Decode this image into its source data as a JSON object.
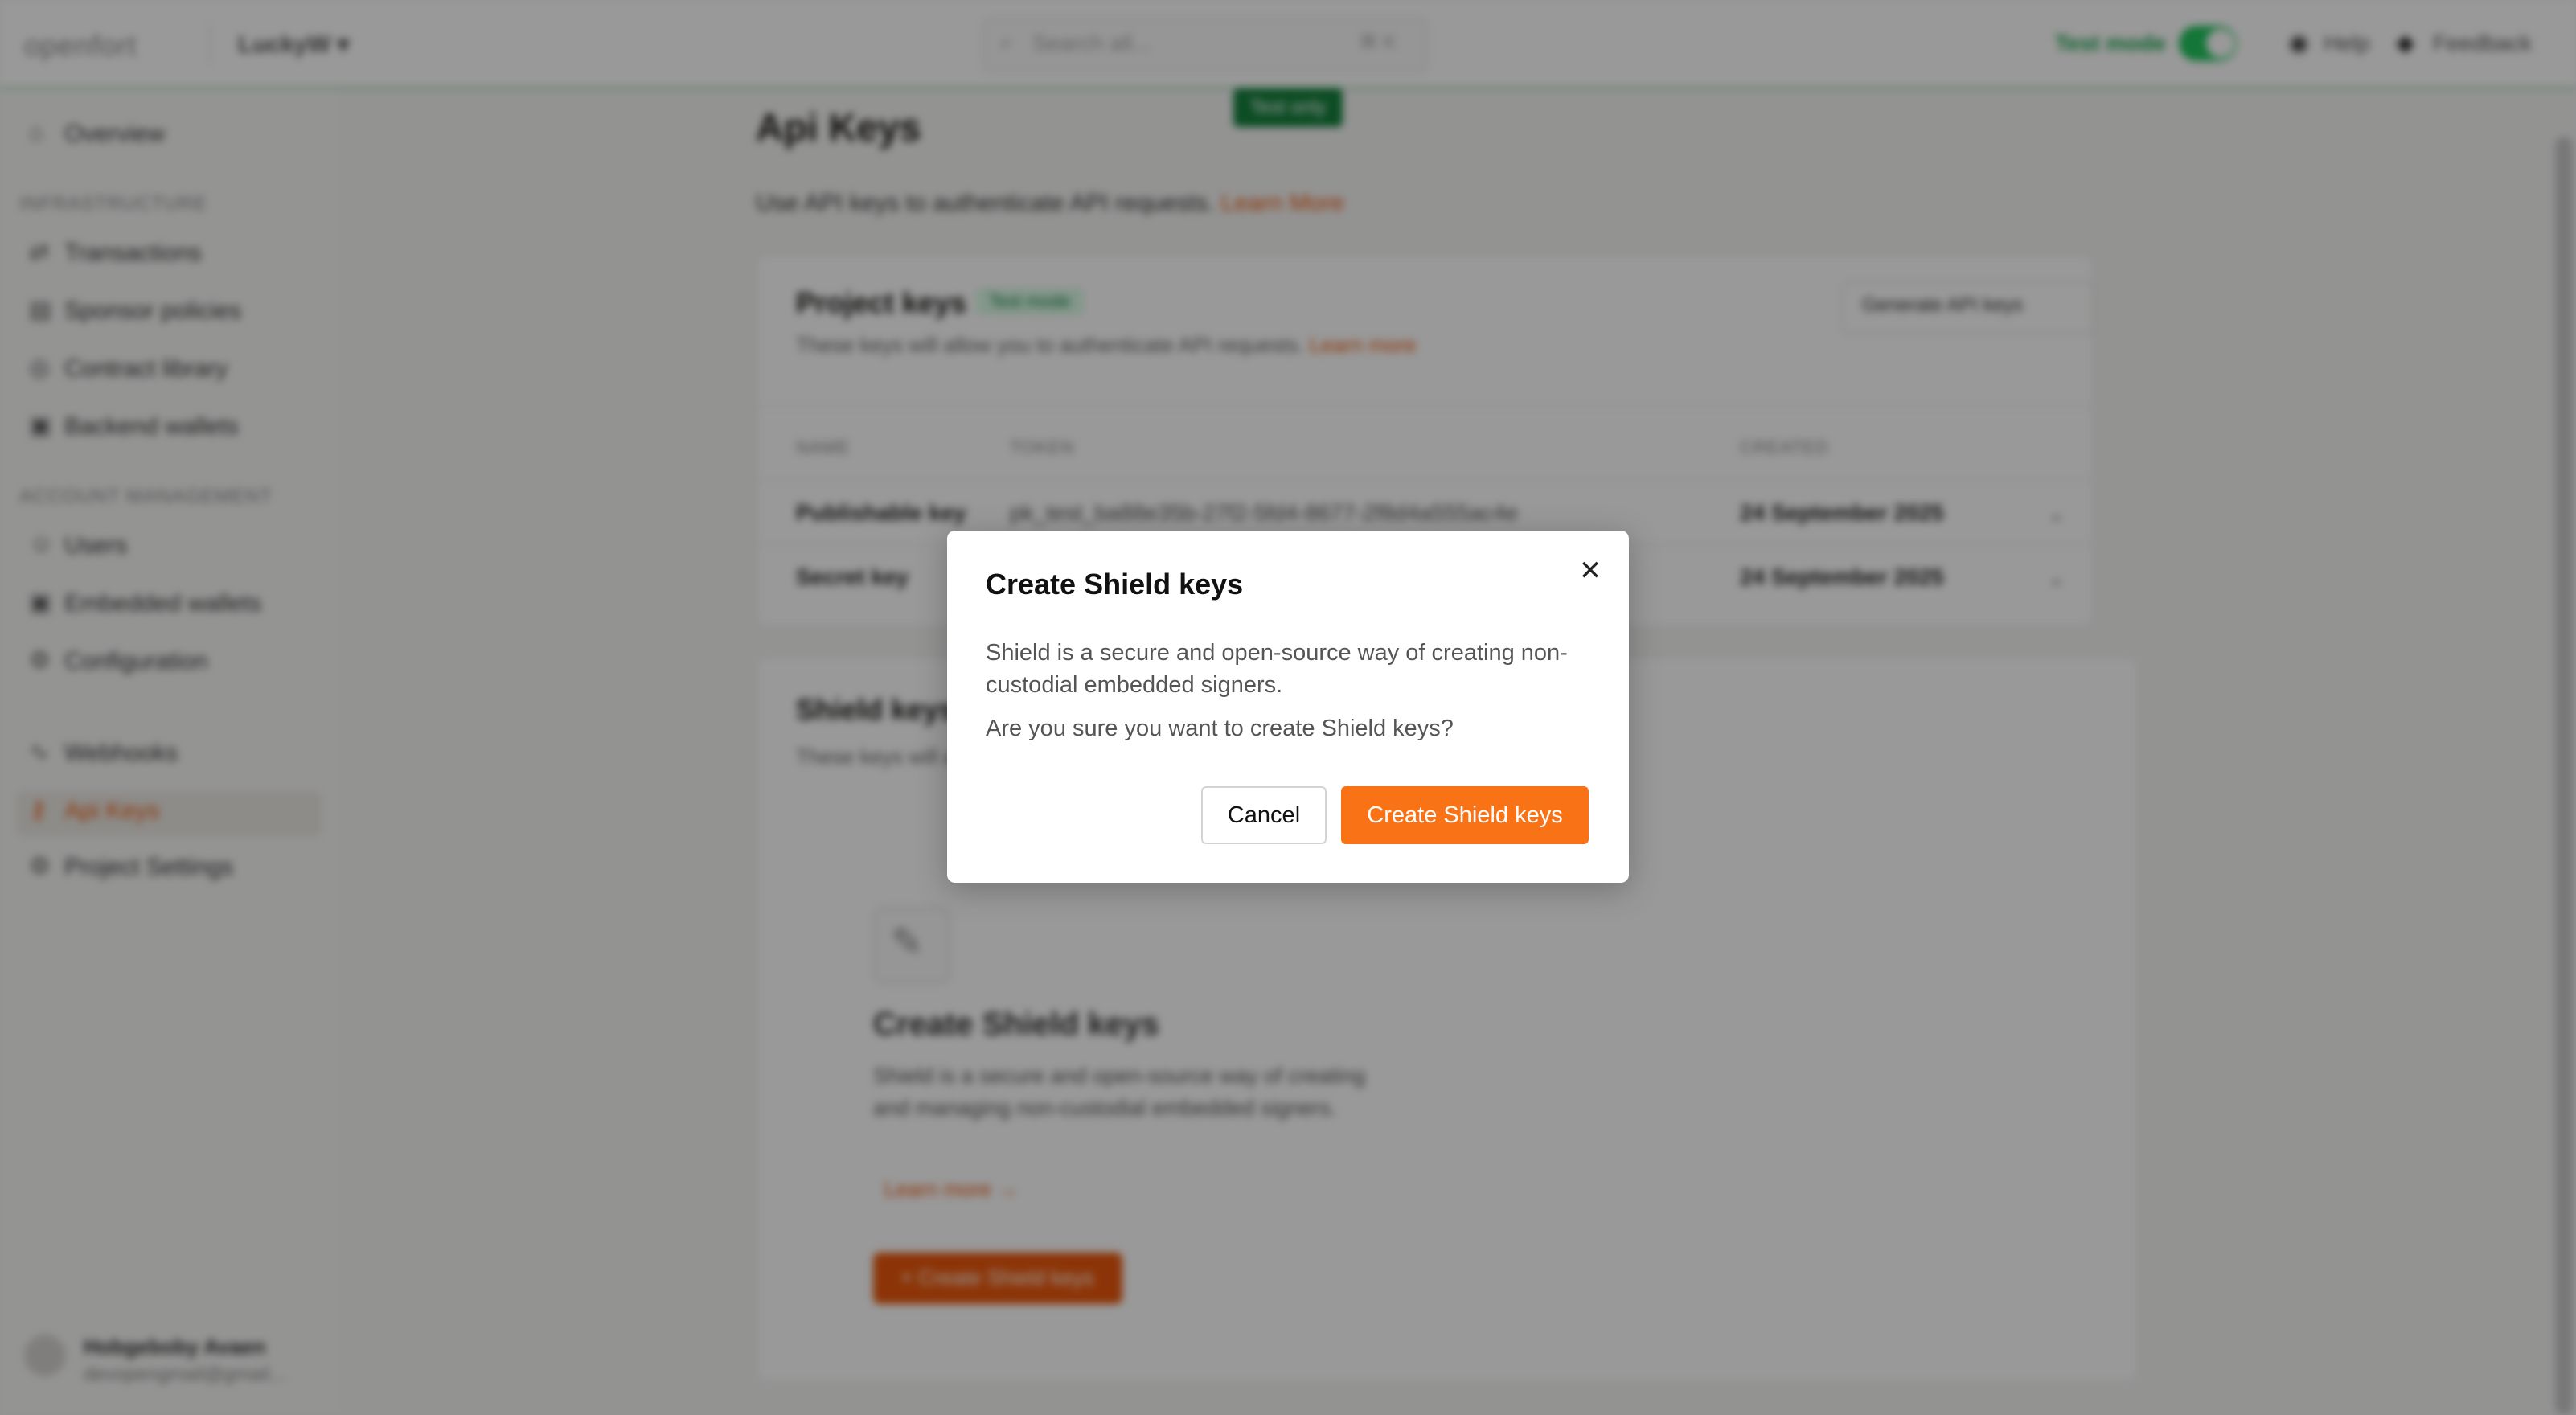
{
  "topbar": {
    "logo": "openfort",
    "project": "LuckyW",
    "project_chevron": "▾",
    "search_placeholder": "Search all...",
    "search_shortcut": "⌘ K",
    "test_mode_label": "Test mode",
    "help_label": "Help",
    "feedback_label": "Feedback",
    "test_pill": "Test only"
  },
  "sidebar": {
    "overview": "Overview",
    "section_infra": "INFRASTRUCTURE",
    "transactions": "Transactions",
    "sponsor_policies": "Sponsor policies",
    "contract_library": "Contract library",
    "backend_wallets": "Backend wallets",
    "section_account": "ACCOUNT MANAGEMENT",
    "users": "Users",
    "embedded_wallets": "Embedded wallets",
    "configuration": "Configuration",
    "webhooks": "Webhooks",
    "api_keys": "Api Keys",
    "project_settings": "Project Settings",
    "user_name": "Hobgeboby Avaen",
    "user_email": "devopengmail@gmail..."
  },
  "page": {
    "title": "Api Keys",
    "subtitle": "Use API keys to authenticate API requests.",
    "subtitle_link": "Learn More"
  },
  "project_keys": {
    "title": "Project keys",
    "badge": "Test mode",
    "subtitle": "These keys will allow you to authenticate API requests.",
    "subtitle_link": "Learn more",
    "generate_button": "Generate API keys",
    "columns": [
      "NAME",
      "TOKEN",
      "CREATED"
    ],
    "rows": [
      {
        "name": "Publishable key",
        "token": "pk_test_ba88e35b-27f2-5fd4-8677-2f8d4a555ac4e",
        "created": "24 September 2025"
      },
      {
        "name": "Secret key",
        "token": "",
        "created": "24 September 2025"
      }
    ]
  },
  "shield_card": {
    "title": "Shield keys",
    "subtitle": "These keys will allow you to...",
    "empty_title": "Create Shield keys",
    "empty_desc": "Shield is a secure and open-source way of creating and managing non-custodial embedded signers.",
    "empty_link": "Learn more",
    "empty_button": "+ Create Shield keys"
  },
  "modal": {
    "title": "Create Shield keys",
    "description": "Shield is a secure and open-source way of creating non-custodial embedded signers.",
    "confirm_question": "Are you sure you want to create Shield keys?",
    "cancel_label": "Cancel",
    "create_label": "Create Shield keys",
    "close_glyph": "✕"
  },
  "colors": {
    "accent": "#f97316",
    "test_green": "#15803d",
    "overlay": "rgba(0,0,0,0.40)"
  }
}
